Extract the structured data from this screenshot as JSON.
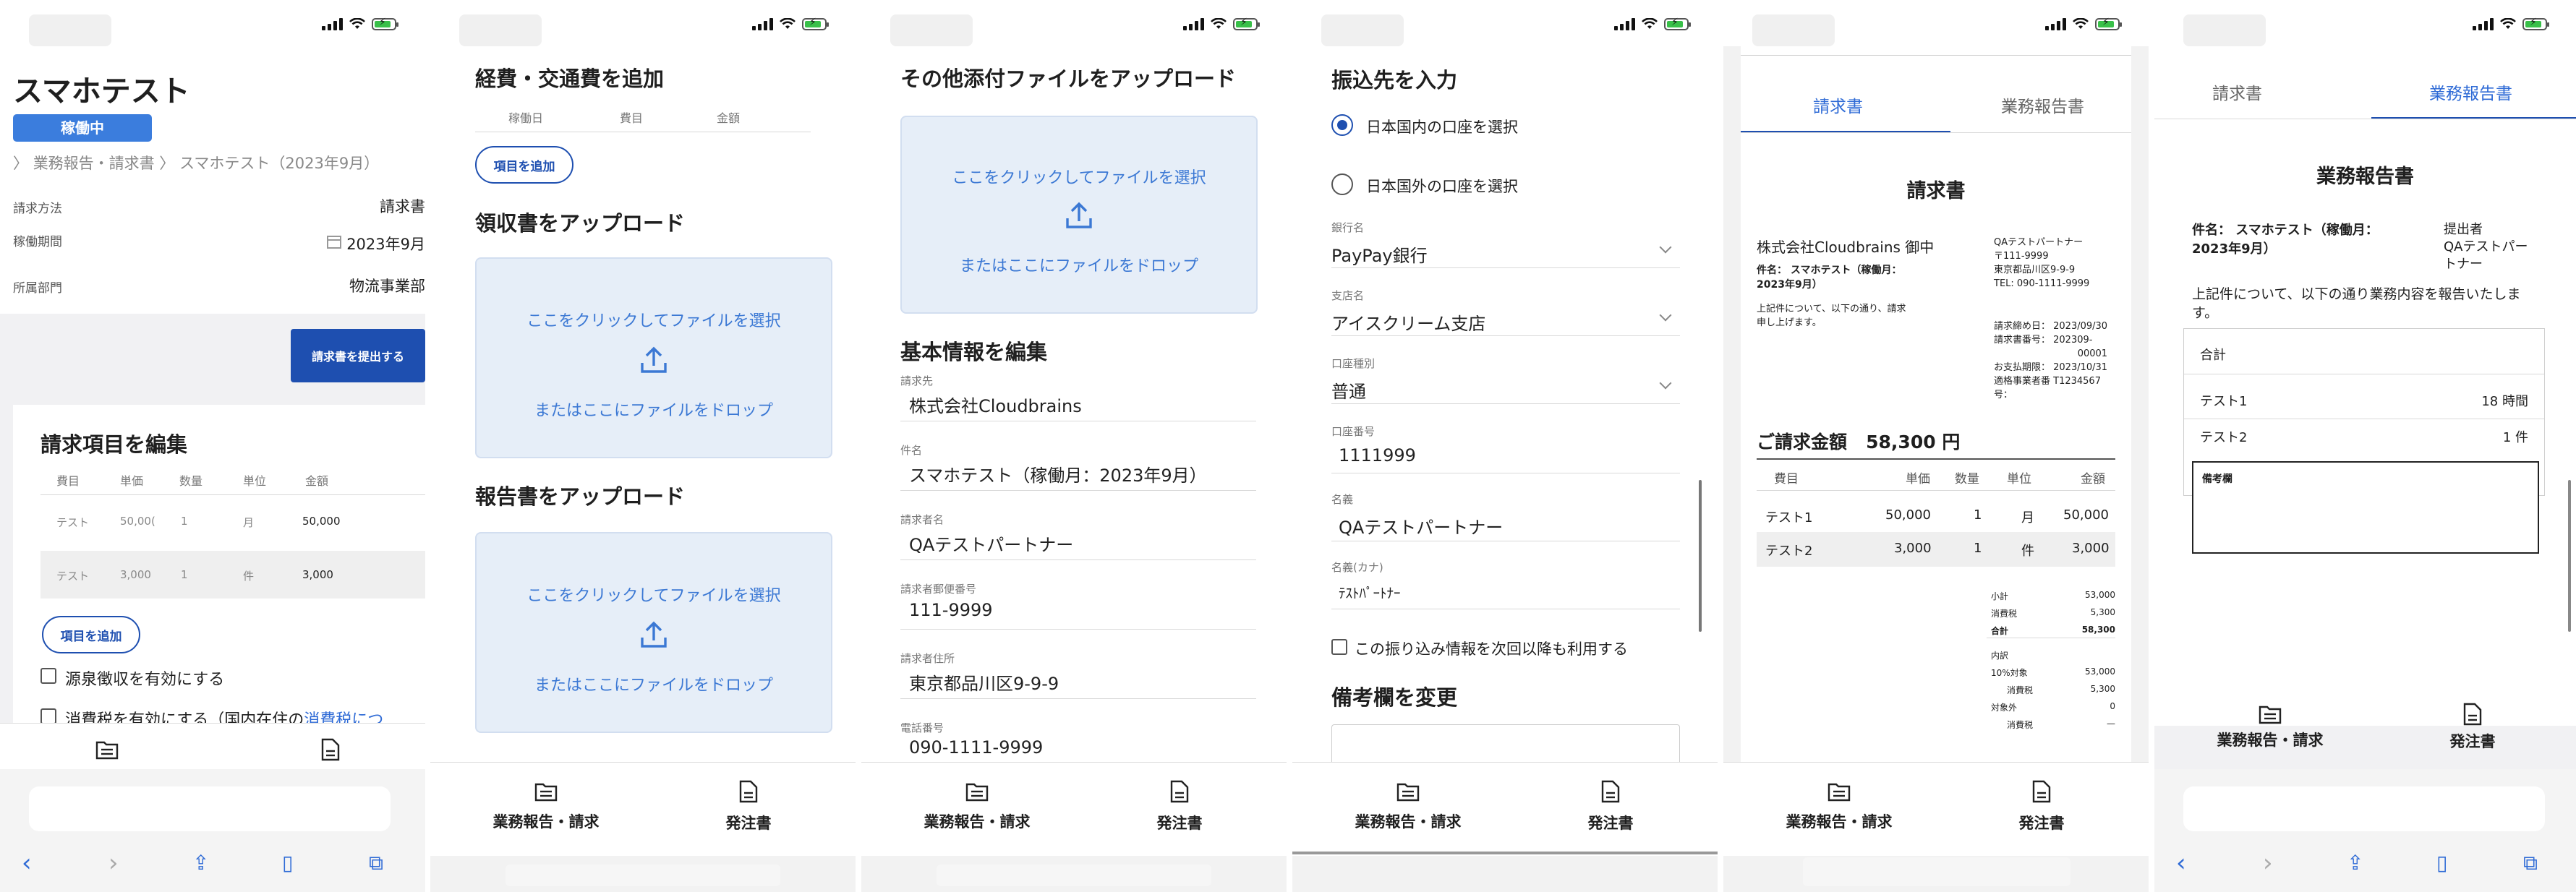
{
  "screen1": {
    "title": "スマホテスト",
    "status_badge": "稼働中",
    "breadcrumb_parent": "業務報告・請求書",
    "breadcrumb_current": "スマホテスト（2023年9月）",
    "rows": [
      {
        "label": "請求方法",
        "value": "請求書"
      },
      {
        "label": "稼働期間",
        "value": "2023年9月"
      },
      {
        "label": "所属部門",
        "value": "物流事業部"
      }
    ],
    "submit_button": "請求書を提出する",
    "edit_title": "請求項目を編集",
    "columns": [
      "費目",
      "単価",
      "数量",
      "単位",
      "金額"
    ],
    "items": [
      {
        "name": "テスト",
        "price": "50,00(",
        "qty": "1",
        "unit": "月",
        "amount": "50,000"
      },
      {
        "name": "テスト",
        "price": "3,000",
        "qty": "1",
        "unit": "件",
        "amount": "3,000"
      }
    ],
    "add_item_button": "項目を追加",
    "withholding_label": "源泉徴収を有効にする",
    "tax_label_prefix": "消費税を有効にする（国内在住の",
    "tax_label_link": "消費税につ"
  },
  "screen2": {
    "expense_title": "経費・交通費を追加",
    "expense_columns": [
      "稼働日",
      "費目",
      "金額"
    ],
    "add_item_button": "項目を追加",
    "receipt_title": "領収書をアップロード",
    "report_title": "報告書をアップロード",
    "drop_click": "ここをクリックしてファイルを選択",
    "drop_drag": "またはここにファイルをドロップ"
  },
  "screen3": {
    "other_title": "その他添付ファイルをアップロード",
    "drop_click": "ここをクリックしてファイルを選択",
    "drop_drag": "またはここにファイルをドロップ",
    "basic_title": "基本情報を編集",
    "fields": [
      {
        "label": "請求先",
        "value": "株式会社Cloudbrains"
      },
      {
        "label": "件名",
        "value": "スマホテスト（稼働月：2023年9月）"
      },
      {
        "label": "請求者名",
        "value": "QAテストパートナー"
      },
      {
        "label": "請求者郵便番号",
        "value": "111-9999"
      },
      {
        "label": "請求者住所",
        "value": "東京都品川区9-9-9"
      },
      {
        "label": "電話番号",
        "value": "090-1111-9999"
      }
    ]
  },
  "screen4": {
    "title": "振込先を入力",
    "domestic": "日本国内の口座を選択",
    "foreign": "日本国外の口座を選択",
    "fields": [
      {
        "label": "銀行名",
        "value": "PayPay銀行"
      },
      {
        "label": "支店名",
        "value": "アイスクリーム支店"
      },
      {
        "label": "口座種別",
        "value": "普通"
      },
      {
        "label": "口座番号",
        "value": "1111999"
      },
      {
        "label": "名義",
        "value": "QAテストパートナー"
      },
      {
        "label": "名義(カナ)",
        "value": "ﾃｽﾄﾊﾟｰﾄﾅｰ"
      }
    ],
    "reuse_label": "この振り込み情報を次回以降も利用する",
    "remarks_title": "備考欄を変更"
  },
  "screen5": {
    "tab_invoice": "請求書",
    "tab_report": "業務報告書",
    "doc_title": "請求書",
    "recipient": "株式会社Cloudbrains 御中",
    "subject": "件名： スマホテスト（稼働月：2023年9月）",
    "intro": "上記件について、以下の通り、請求申し上げます。",
    "sender_lines": [
      "QAテストパートナー",
      "〒111-9999",
      "東京都品川区9-9-9",
      "TEL: 090-1111-9999"
    ],
    "meta_lines": [
      "請求締め日： 2023/09/30",
      "請求書番号： 202309-",
      "00001",
      "お支払期限： 2023/10/31",
      "適格事業者番 T1234567",
      "号："
    ],
    "total_label": "ご請求金額",
    "total_value": "58,300 円",
    "columns": [
      "費目",
      "単価",
      "数量",
      "単位",
      "金額"
    ],
    "items": [
      {
        "name": "テスト1",
        "price": "50,000",
        "qty": "1",
        "unit": "月",
        "amount": "50,000"
      },
      {
        "name": "テスト2",
        "price": "3,000",
        "qty": "1",
        "unit": "件",
        "amount": "3,000"
      }
    ],
    "summary": [
      {
        "label": "小計",
        "value": "53,000"
      },
      {
        "label": "消費税",
        "value": "5,300"
      },
      {
        "label": "合計",
        "value": "58,300"
      }
    ],
    "breakdown_title": "内訳",
    "breakdown": [
      {
        "label": "10%対象",
        "value": "53,000"
      },
      {
        "label": "消費税",
        "value": "5,300"
      },
      {
        "label": "対象外",
        "value": "0"
      },
      {
        "label": "消費税",
        "value": "—"
      }
    ]
  },
  "screen6": {
    "tab_invoice": "請求書",
    "tab_report": "業務報告書",
    "doc_title": "業務報告書",
    "subject": "件名： スマホテスト（稼働月：2023年9月）",
    "submitter_label": "提出者",
    "submitter_name": "QAテストパートナー",
    "intro": "上記件について、以下の通り業務内容を報告いたします。",
    "summary_title": "合計",
    "rows": [
      {
        "name": "テスト1",
        "value": "18 時間"
      },
      {
        "name": "テスト2",
        "value": "1 件"
      }
    ],
    "remarks_title": "備考欄"
  },
  "tabbar": {
    "left": "業務報告・請求",
    "right": "発注書"
  },
  "icons": [
    "document-list-icon",
    "document-icon",
    "upload-icon",
    "calendar-icon",
    "back-icon",
    "forward-icon",
    "share-icon",
    "bookmarks-icon",
    "tabs-icon"
  ],
  "colors": {
    "primary": "#1e4fb0",
    "accent": "#2f6bd6",
    "drop_bg": "#e6eef8",
    "badge": "#3b7ddd"
  }
}
